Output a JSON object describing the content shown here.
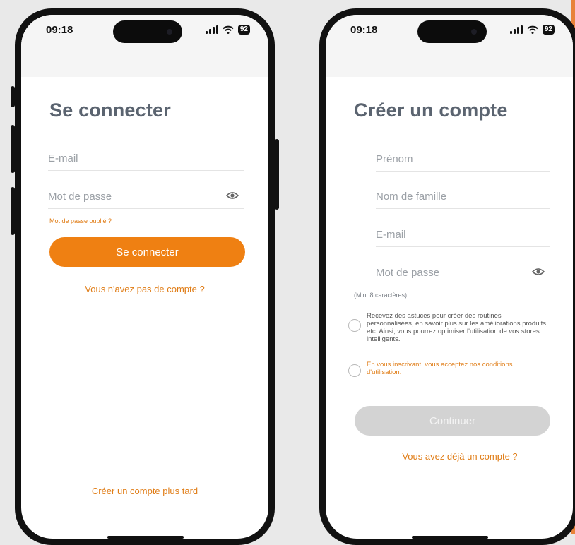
{
  "status": {
    "time": "09:18",
    "battery": "92"
  },
  "login": {
    "title": "Se connecter",
    "email_placeholder": "E-mail",
    "password_placeholder": "Mot de passe",
    "forgot_password": "Mot de passe oublié ?",
    "submit_label": "Se connecter",
    "no_account": "Vous n'avez pas de compte ?",
    "create_later": "Créer un compte plus tard"
  },
  "signup": {
    "title": "Créer un compte",
    "first_name_placeholder": "Prénom",
    "last_name_placeholder": "Nom de famille",
    "email_placeholder": "E-mail",
    "password_placeholder": "Mot de passe",
    "password_hint": "(Min. 8 caractères)",
    "newsletter_text": "Recevez des astuces pour créer des routines personnalisées, en savoir plus sur les améliorations produits, etc. Ainsi, vous pourrez optimiser l'utilisation de vos stores intelligents.",
    "terms_text": "En vous inscrivant, vous acceptez nos conditions d'utilisation.",
    "continue_label": "Continuer",
    "have_account": "Vous avez déjà un compte ?"
  },
  "colors": {
    "accent": "#ef8012",
    "link": "#e07d17",
    "title": "#5b6470",
    "disabled": "#d3d3d3"
  }
}
